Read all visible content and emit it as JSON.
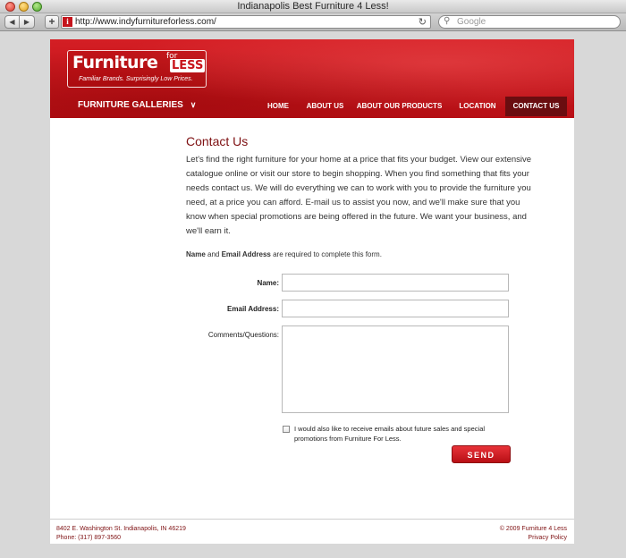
{
  "window": {
    "title": "Indianapolis Best Furniture 4 Less!"
  },
  "toolbar": {
    "back_icon": "back-arrow-icon",
    "forward_icon": "forward-arrow-icon",
    "add_icon": "plus-icon",
    "url": "http://www.indyfurnitureforless.com/",
    "search_placeholder": "Google"
  },
  "logo": {
    "main": "Furniture",
    "for": "for",
    "less": "LESS",
    "tagline": "Familiar Brands. Surprisingly Low Prices."
  },
  "nav": {
    "galleries": "FURNITURE GALLERIES",
    "items": [
      {
        "label": "HOME"
      },
      {
        "label": "ABOUT US"
      },
      {
        "label": "ABOUT OUR PRODUCTS"
      },
      {
        "label": "LOCATION"
      },
      {
        "label": "CONTACT US",
        "active": true
      }
    ]
  },
  "content": {
    "heading": "Contact Us",
    "intro": "Let's find the right furniture for your home at a price that fits your budget. View our extensive catalogue online or visit our store to begin shopping. When you find something that fits your needs contact us. We will do everything we can to work with you to provide the furniture you need, at a price you can afford. E-mail us to assist you now, and we'll make sure that you know when special promotions are being offered in the future. We want your business, and we'll earn it.",
    "required_name": "Name",
    "required_and": " and ",
    "required_email": "Email Address",
    "required_rest": " are required to complete this form."
  },
  "form": {
    "name_label": "Name:",
    "name_value": "",
    "email_label": "Email Address:",
    "email_value": "",
    "comments_label": "Comments/Questions:",
    "comments_value": "",
    "checkbox_checked": false,
    "checkbox_label": "I would also like to receive emails about future sales and special promotions from Furniture For Less.",
    "send_label": "SEND"
  },
  "footer": {
    "address": "8402 E. Washington St. Indianapolis, IN 46219",
    "phone": "Phone: (317) 897-3560",
    "copyright": "© 2009 Furniture 4 Less",
    "privacy": "Privacy Policy"
  },
  "colors": {
    "brand_red": "#c8141b",
    "heading_red": "#7e1012",
    "active_nav": "#6a0d10"
  }
}
